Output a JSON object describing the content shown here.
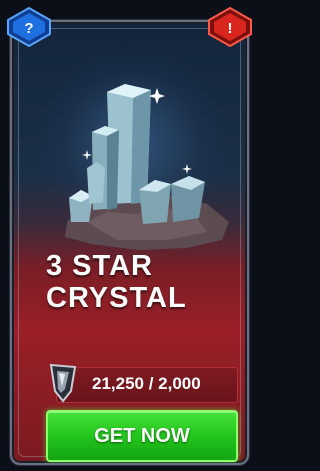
{
  "item": {
    "title_line1": "3 STAR",
    "title_line2": "CRYSTAL"
  },
  "currency": {
    "owned": "21,250",
    "cost": "2,000",
    "display": "21,250 / 2,000",
    "icon": "shard-icon"
  },
  "actions": {
    "get_now_label": "GET NOW"
  },
  "corner_buttons": {
    "help_glyph": "?",
    "alert_glyph": "!"
  },
  "colors": {
    "card_red": "#9a1f28",
    "button_green": "#22c51c",
    "help_blue": "#1e6fe0",
    "alert_red": "#d8261e"
  }
}
